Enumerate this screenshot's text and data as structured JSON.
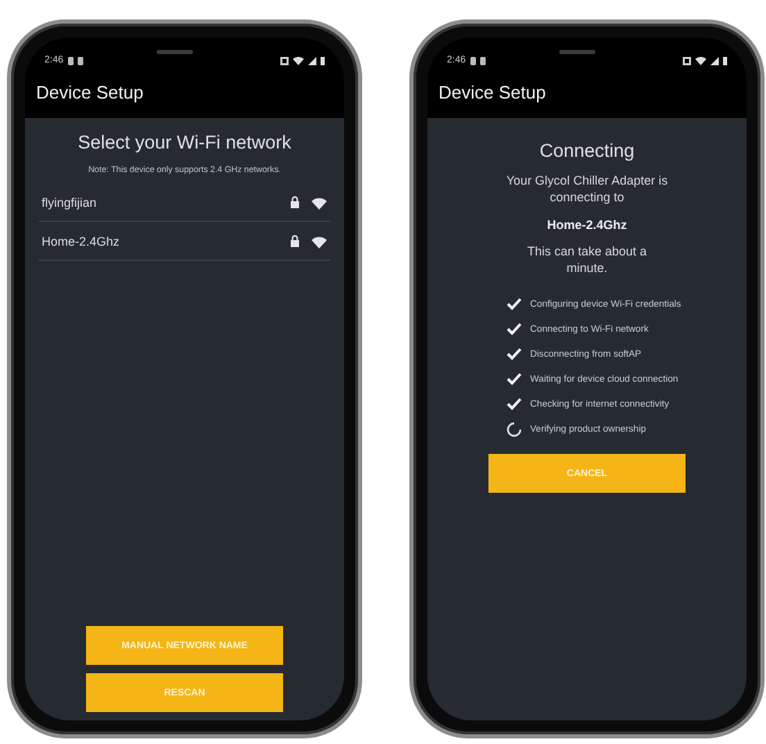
{
  "phones": [
    {
      "kind": "network-list",
      "status_bar": {
        "time": "2:46"
      },
      "app_bar": {
        "title": "Device Setup"
      },
      "heading": "Select your Wi-Fi network",
      "note": "Note: This device only supports 2.4 GHz networks.",
      "networks": [
        {
          "name": "flyingfijian",
          "locked": true
        },
        {
          "name": "Home-2.4Ghz",
          "locked": true
        }
      ],
      "buttons": [
        "MANUAL NETWORK NAME",
        "RESCAN"
      ]
    },
    {
      "kind": "connecting",
      "status_bar": {
        "time": "2:46"
      },
      "app_bar": {
        "title": "Device Setup"
      },
      "heading": "Connecting",
      "message": "Your Glycol Chiller Adapter is connecting to",
      "network": "Home-2.4Ghz",
      "wait_note": "This can take about a minute.",
      "steps": [
        {
          "label": "Configuring device Wi-Fi credentials",
          "done": true
        },
        {
          "label": "Connecting to Wi-Fi network",
          "done": true
        },
        {
          "label": "Disconnecting from softAP",
          "done": true
        },
        {
          "label": "Waiting for device cloud connection",
          "done": true
        },
        {
          "label": "Checking for internet connectivity",
          "done": true
        },
        {
          "label": "Verifying product ownership",
          "done": false
        }
      ],
      "buttons": [
        "CANCEL"
      ]
    }
  ]
}
